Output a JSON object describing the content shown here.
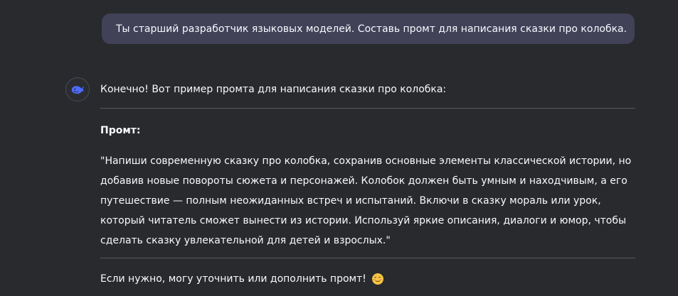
{
  "user_message": {
    "text": "Ты старший разработчик языковых моделей. Составь промт для написания сказки про колобка."
  },
  "assistant_message": {
    "avatar_icon": "whale-logo-icon",
    "intro": "Конечно! Вот пример промта для написания сказки про колобка:",
    "prompt_heading": "Промт:",
    "prompt_body": "\"Напиши современную сказку про колобка, сохранив основные элементы классической истории, но добавив новые повороты сюжета и персонажей. Колобок должен быть умным и находчивым, а его путешествие — полным неожиданных встреч и испытаний. Включи в сказку мораль или урок, который читатель сможет вынести из истории. Используй яркие описания, диалоги и юмор, чтобы сделать сказку увлекательной для детей и взрослых.\"",
    "outro": "Если нужно, могу уточнить или дополнить промт!",
    "outro_emoji": "smiling-face-emoji"
  },
  "colors": {
    "background": "#292a2d",
    "user_bubble": "#414158",
    "text": "#f8faff",
    "divider": "#5a5b60",
    "accent_logo": "#4d6bfe"
  }
}
